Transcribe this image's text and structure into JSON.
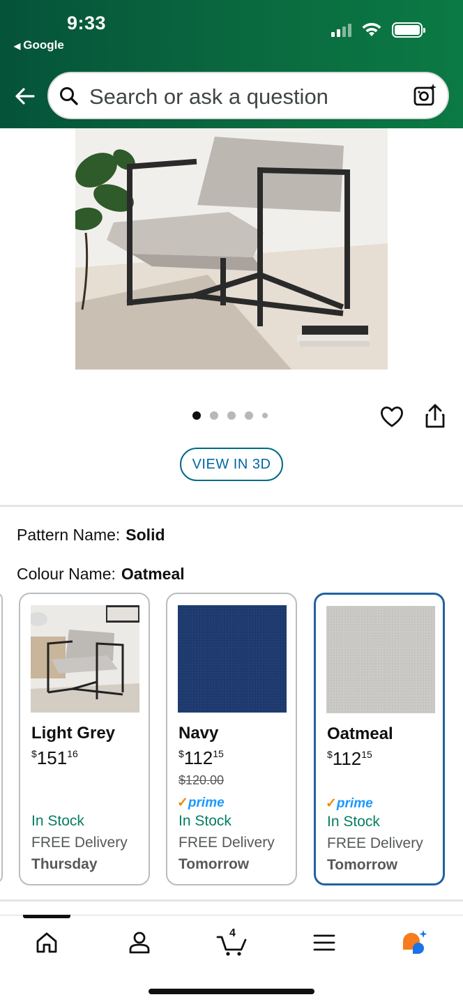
{
  "status_bar": {
    "time": "9:33",
    "back_app": "Google"
  },
  "search": {
    "placeholder": "Search or ask a question"
  },
  "product": {
    "image_count": 5,
    "active_image_index": 1,
    "view_3d_label": "VIEW IN 3D"
  },
  "variations": {
    "pattern_label": "Pattern Name:",
    "pattern_value": "Solid",
    "colour_label": "Colour Name:",
    "colour_value": "Oatmeal",
    "options": [
      {
        "name": "Light Grey",
        "price_symbol": "$",
        "price_whole": "151",
        "price_fraction": "16",
        "stock": "In Stock",
        "delivery": "FREE Delivery",
        "when": "Thursday"
      },
      {
        "name": "Navy",
        "price_symbol": "$",
        "price_whole": "112",
        "price_fraction": "15",
        "old_price": "$120.00",
        "prime": "prime",
        "stock": "In Stock",
        "delivery": "FREE Delivery",
        "when": "Tomorrow"
      },
      {
        "name": "Oatmeal",
        "price_symbol": "$",
        "price_whole": "112",
        "price_fraction": "15",
        "prime": "prime",
        "stock": "In Stock",
        "delivery": "FREE Delivery",
        "when": "Tomorrow",
        "selected": true
      }
    ]
  },
  "bottom_nav": {
    "cart_count": "4",
    "items": [
      "home-icon",
      "account-icon",
      "cart-icon",
      "menu-icon",
      "rufus-assistant-icon"
    ]
  },
  "colors": {
    "header": "#0a6a3f",
    "link": "#0066a1",
    "in_stock": "#067d62",
    "selected_border": "#2162a1",
    "prime": "#1a98ff"
  }
}
